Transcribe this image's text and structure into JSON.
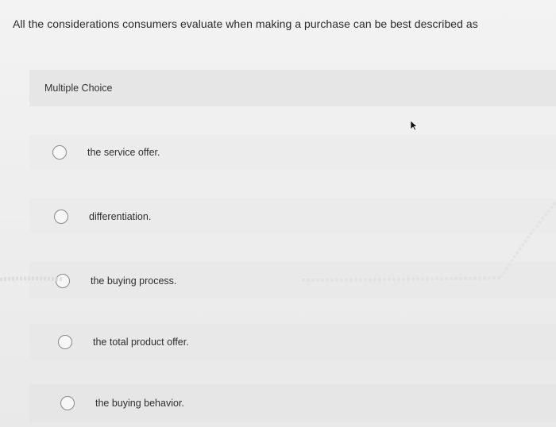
{
  "question": {
    "text": "All the considerations consumers evaluate when making a purchase can be best described as"
  },
  "multiple_choice": {
    "label": "Multiple Choice",
    "options": [
      {
        "label": "the service offer.",
        "selected": false
      },
      {
        "label": "differentiation.",
        "selected": false
      },
      {
        "label": "the buying process.",
        "selected": false
      },
      {
        "label": "the total product offer.",
        "selected": false
      },
      {
        "label": "the buying behavior.",
        "selected": false
      }
    ]
  },
  "icons": {
    "cursor": "mouse-pointer-icon",
    "radio": "radio-circle-icon"
  },
  "colors": {
    "background": "#efefef",
    "header_band": "#e6e6e6",
    "radio_border": "#8a8a8a",
    "text": "#2b2b2b"
  }
}
